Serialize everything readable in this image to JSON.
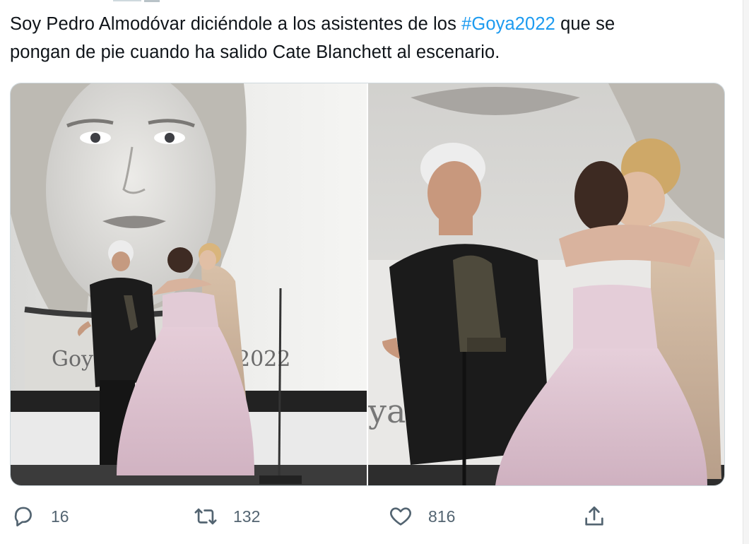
{
  "tweet": {
    "text_line1_before": "Soy Pedro Almodóvar diciéndole a los asistentes de los ",
    "hashtag": "#Goya2022",
    "text_line1_after": " que se",
    "text_line2": "pongan de pie cuando ha salido Cate Blanchett al escenario."
  },
  "media": {
    "photos": [
      {
        "backdrop_text": "Goya",
        "backdrop_year": "2022"
      },
      {
        "backdrop_text": "ya"
      }
    ]
  },
  "actions": {
    "reply": {
      "icon": "reply-icon",
      "count": "16"
    },
    "retweet": {
      "icon": "retweet-icon",
      "count": "132"
    },
    "like": {
      "icon": "heart-icon",
      "count": "816"
    },
    "share": {
      "icon": "share-icon"
    }
  },
  "colors": {
    "text": "#0f1419",
    "hashtag": "#1d9bf0",
    "action_gray": "#536471",
    "border": "#cfd9de"
  }
}
